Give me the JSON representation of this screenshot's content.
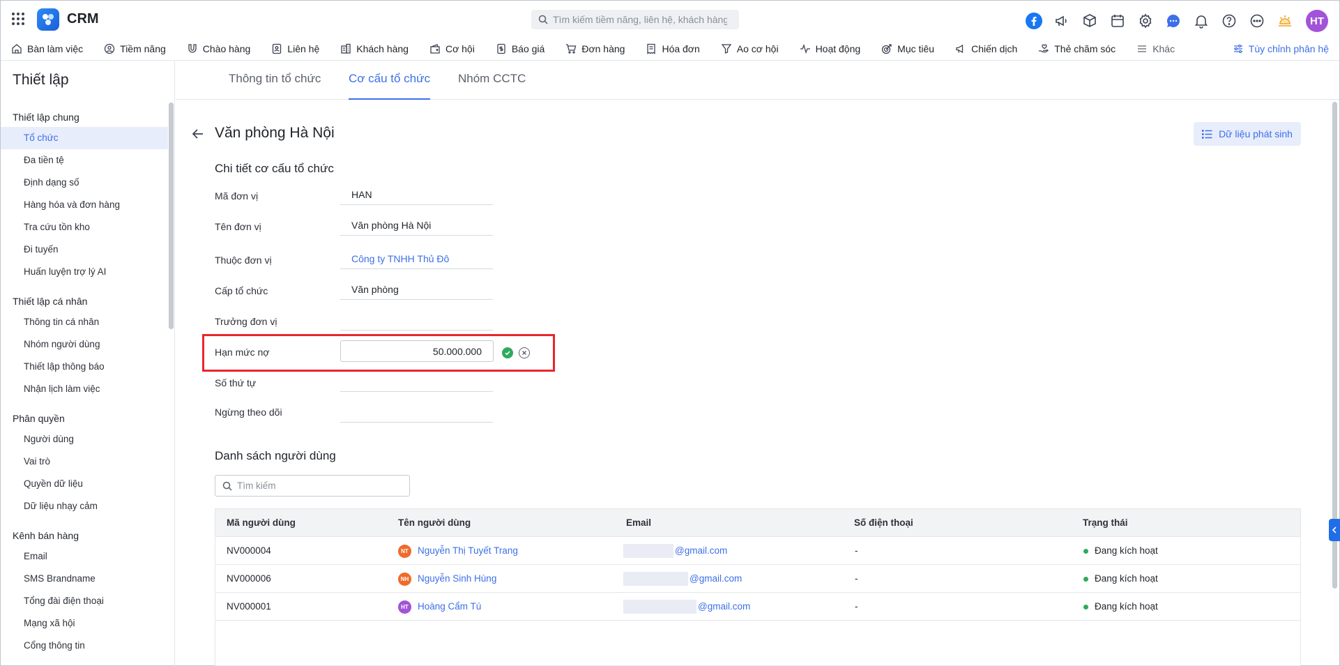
{
  "app": {
    "name": "CRM"
  },
  "header": {
    "search_placeholder": "Tìm kiếm tiềm năng, liên hệ, khách hàng",
    "avatar_initials": "HT"
  },
  "modules": [
    {
      "label": "Bàn làm việc",
      "icon": "home-icon"
    },
    {
      "label": "Tiềm năng",
      "icon": "user-circle-icon"
    },
    {
      "label": "Chào hàng",
      "icon": "magnet-icon"
    },
    {
      "label": "Liên hệ",
      "icon": "contact-card-icon"
    },
    {
      "label": "Khách hàng",
      "icon": "building-icon"
    },
    {
      "label": "Cơ hội",
      "icon": "wallet-icon"
    },
    {
      "label": "Báo giá",
      "icon": "dollar-doc-icon"
    },
    {
      "label": "Đơn hàng",
      "icon": "cart-icon"
    },
    {
      "label": "Hóa đơn",
      "icon": "invoice-icon"
    },
    {
      "label": "Ao cơ hội",
      "icon": "funnel-icon"
    },
    {
      "label": "Hoạt động",
      "icon": "activity-icon"
    },
    {
      "label": "Mục tiêu",
      "icon": "target-icon"
    },
    {
      "label": "Chiến dịch",
      "icon": "megaphone-icon"
    },
    {
      "label": "Thẻ chăm sóc",
      "icon": "care-icon"
    },
    {
      "label": "Khác",
      "icon": "menu-icon"
    }
  ],
  "customize_label": "Tùy chỉnh phân hệ",
  "sidebar": {
    "title": "Thiết lập",
    "groups": [
      {
        "title": "Thiết lập chung",
        "items": [
          "Tổ chức",
          "Đa tiền tệ",
          "Định dạng số",
          "Hàng hóa và đơn hàng",
          "Tra cứu tồn kho",
          "Đi tuyến",
          "Huấn luyện trợ lý AI"
        ]
      },
      {
        "title": "Thiết lập cá nhân",
        "items": [
          "Thông tin cá nhân",
          "Nhóm người dùng",
          "Thiết lập thông báo",
          "Nhận lịch làm việc"
        ]
      },
      {
        "title": "Phân quyền",
        "items": [
          "Người dùng",
          "Vai trò",
          "Quyền dữ liệu",
          "Dữ liệu nhạy cảm"
        ]
      },
      {
        "title": "Kênh bán hàng",
        "items": [
          "Email",
          "SMS Brandname",
          "Tổng đài điện thoại",
          "Mạng xã hội",
          "Cổng thông tin"
        ]
      }
    ],
    "active_item": "Tổ chức"
  },
  "tabs": [
    {
      "label": "Thông tin tổ chức",
      "active": false
    },
    {
      "label": "Cơ cấu tổ chức",
      "active": true
    },
    {
      "label": "Nhóm CCTC",
      "active": false
    }
  ],
  "page": {
    "title": "Văn phòng Hà Nội",
    "generated_data_button": "Dữ liệu phát sinh",
    "section_title": "Chi tiết cơ cấu tổ chức",
    "fields": {
      "code": {
        "label": "Mã đơn vị",
        "value": "HAN"
      },
      "name": {
        "label": "Tên đơn vị",
        "value": "Văn phòng Hà Nội"
      },
      "parent": {
        "label": "Thuộc đơn vị",
        "value": "Công ty TNHH Thủ Đô"
      },
      "level": {
        "label": "Cấp tổ chức",
        "value": "Văn phòng"
      },
      "head": {
        "label": "Trưởng đơn vị",
        "value": ""
      },
      "debt_limit": {
        "label": "Hạn mức nợ",
        "value": "50.000.000"
      },
      "order": {
        "label": "Số thứ tự",
        "value": ""
      },
      "inactive": {
        "label": "Ngừng theo dõi",
        "value": ""
      }
    }
  },
  "users": {
    "title": "Danh sách người dùng",
    "search_placeholder": "Tìm kiếm",
    "columns": [
      "Mã người dùng",
      "Tên người dùng",
      "Email",
      "Số điện thoại",
      "Trạng thái"
    ],
    "rows": [
      {
        "code": "NV000004",
        "initials": "NT",
        "avatar_color": "#f06a2c",
        "name": "Nguyễn Thị Tuyết Trang",
        "email": "@gmail.com",
        "phone": "-",
        "status": "Đang kích hoạt"
      },
      {
        "code": "NV000006",
        "initials": "NH",
        "avatar_color": "#f06a2c",
        "name": "Nguyễn Sinh Hùng",
        "email": "@gmail.com",
        "phone": "-",
        "status": "Đang kích hoạt"
      },
      {
        "code": "NV000001",
        "initials": "HT",
        "avatar_color": "#a253d8",
        "name": "Hoàng Cẩm Tú",
        "email": "@gmail.com",
        "phone": "-",
        "status": "Đang kích hoạt"
      }
    ]
  },
  "colors": {
    "accent": "#3d6fe8",
    "highlight": "#e8262d",
    "success": "#2faa5d"
  }
}
